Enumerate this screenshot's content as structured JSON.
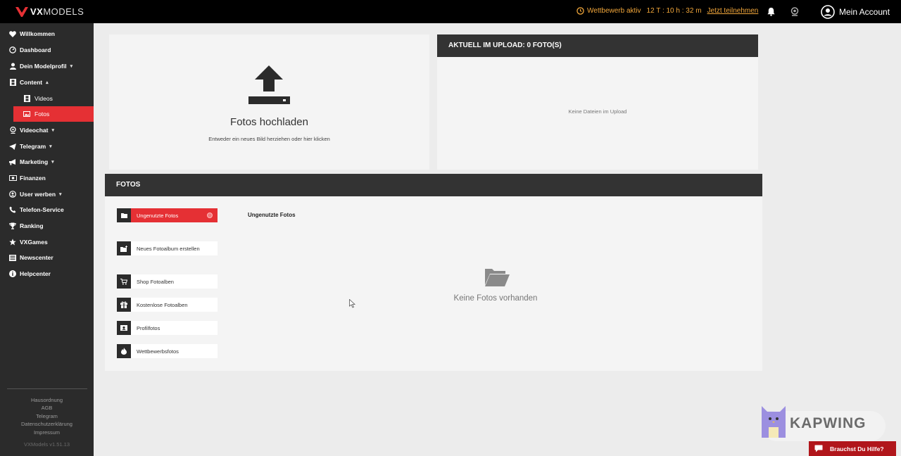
{
  "topbar": {
    "logo_bold": "VX",
    "logo_thin": "MODELS",
    "contest_label": "Wettbewerb aktiv",
    "contest_timer": "12 T : 10 h : 32 m",
    "contest_link": "Jetzt teilnehmen",
    "account_label": "Mein Account"
  },
  "sidebar": {
    "items": [
      {
        "label": "Willkommen",
        "icon": "heart-icon"
      },
      {
        "label": "Dashboard",
        "icon": "gauge-icon"
      },
      {
        "label": "Dein Modelprofil",
        "icon": "user-icon",
        "chevron": "▾"
      },
      {
        "label": "Content",
        "icon": "film-icon",
        "chevron": "▴"
      },
      {
        "label": "Videos",
        "icon": "film-icon"
      },
      {
        "label": "Fotos",
        "icon": "image-icon"
      },
      {
        "label": "Videochat",
        "icon": "webcam-icon",
        "chevron": "▾"
      },
      {
        "label": "Telegram",
        "icon": "paper-plane-icon",
        "chevron": "▾"
      },
      {
        "label": "Marketing",
        "icon": "megaphone-icon",
        "chevron": "▾"
      },
      {
        "label": "Finanzen",
        "icon": "money-icon"
      },
      {
        "label": "User werben",
        "icon": "users-icon",
        "chevron": "▾"
      },
      {
        "label": "Telefon-Service",
        "icon": "phone-icon"
      },
      {
        "label": "Ranking",
        "icon": "trophy-icon"
      },
      {
        "label": "VXGames",
        "icon": "star-icon"
      },
      {
        "label": "Newscenter",
        "icon": "news-icon"
      },
      {
        "label": "Helpcenter",
        "icon": "info-icon"
      }
    ],
    "footer_links": [
      "Hausordnung",
      "AGB",
      "Telegram",
      "Datenschutzerklärung",
      "Impressum"
    ],
    "version": "VXModels v1.51.13"
  },
  "upload": {
    "title": "Fotos hochladen",
    "subtitle": "Entweder ein neues Bild herziehen oder hier klicken"
  },
  "queue": {
    "header": "AKTUELL IM UPLOAD: 0 FOTO(S)",
    "empty": "Keine Dateien im Upload"
  },
  "fotos": {
    "header": "FOTOS",
    "albums": [
      {
        "label": "Ungenutzte Fotos",
        "icon": "folder-icon",
        "active": true
      },
      {
        "label": "Neues Fotoalbum erstellen",
        "icon": "folder-plus-icon"
      },
      {
        "label": "Shop Fotoalben",
        "icon": "cart-icon"
      },
      {
        "label": "Kostenlose Fotoalben",
        "icon": "gift-icon"
      },
      {
        "label": "Profilfotos",
        "icon": "id-card-icon"
      },
      {
        "label": "Wettbewerbsfotos",
        "icon": "flame-icon"
      }
    ],
    "section_label": "Ungenutzte Fotos",
    "empty_text": "Keine Fotos vorhanden"
  },
  "watermark": "KAPWING",
  "help_button": "Brauchst Du Hilfe?",
  "colors": {
    "accent": "#e53034",
    "sidebar_bg": "#2b2b2b",
    "topbar_bg": "#000000",
    "contest": "#f2a73b"
  }
}
